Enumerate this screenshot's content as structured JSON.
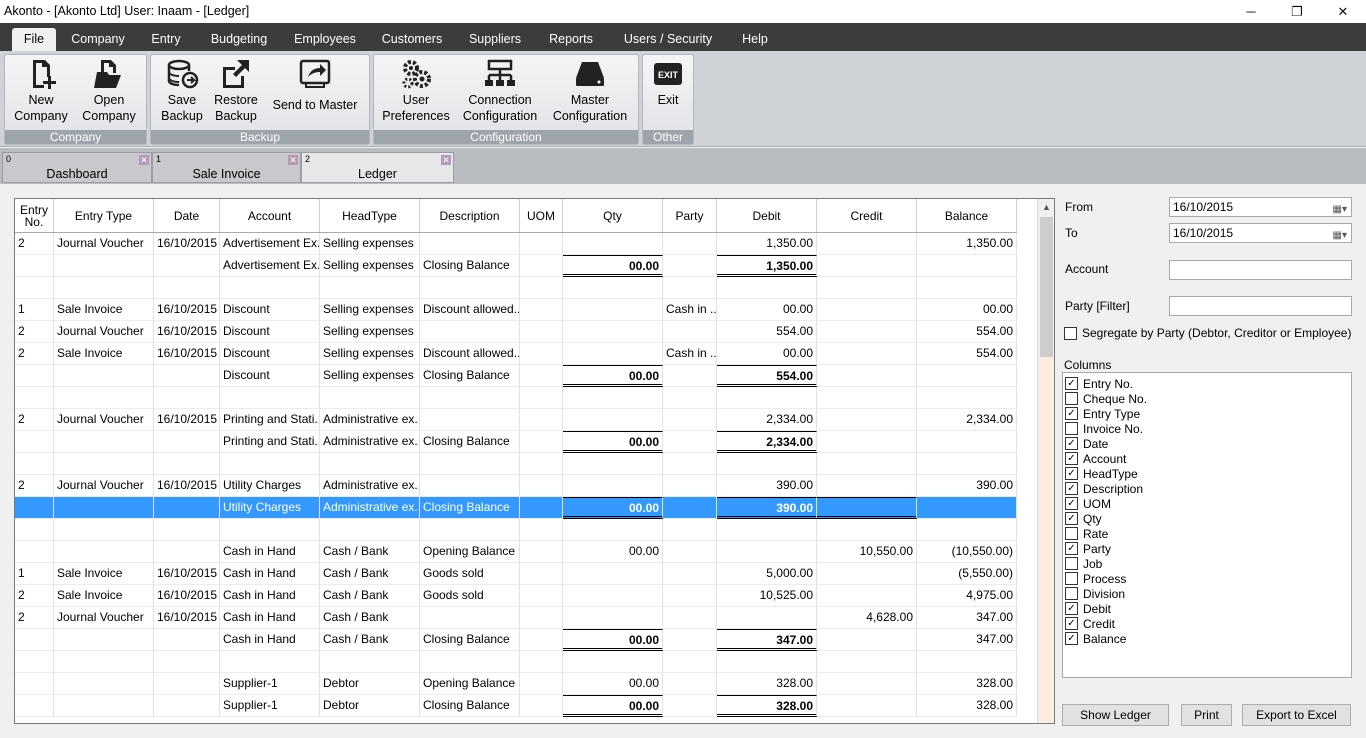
{
  "window": {
    "title": "Akonto - [Akonto Ltd]  User: Inaam - [Ledger]",
    "controls": [
      "─",
      "❐",
      "✕"
    ]
  },
  "menu": [
    "File",
    "Company",
    "Entry",
    "Budgeting",
    "Employees",
    "Customers",
    "Suppliers",
    "Reports",
    "Users / Security",
    "Help"
  ],
  "ribbon": {
    "groups": [
      {
        "label": "Company",
        "buttons": [
          "New\nCompany",
          "Open\nCompany"
        ]
      },
      {
        "label": "Backup",
        "buttons": [
          "Save\nBackup",
          "Restore\nBackup",
          "Send to Master"
        ]
      },
      {
        "label": "Configuration",
        "buttons": [
          "User\nPreferences",
          "Connection\nConfiguration",
          "Master\nConfiguration"
        ]
      },
      {
        "label": "Other",
        "buttons": [
          "Exit"
        ]
      }
    ],
    "icons": [
      "new-company-icon",
      "open-company-icon",
      "save-backup-icon",
      "restore-backup-icon",
      "send-to-master-icon",
      "user-preferences-icon",
      "connection-config-icon",
      "master-config-icon",
      "exit-icon"
    ]
  },
  "doc_tabs": [
    {
      "num": "0",
      "label": "Dashboard"
    },
    {
      "num": "1",
      "label": "Sale Invoice"
    },
    {
      "num": "2",
      "label": "Ledger"
    }
  ],
  "grid": {
    "headers": [
      "Entry\nNo.",
      "Entry Type",
      "Date",
      "Account",
      "HeadType",
      "Description",
      "UOM",
      "Qty",
      "Party",
      "Debit",
      "Credit",
      "Balance"
    ],
    "rows": [
      {
        "cells": [
          "2",
          "Journal Voucher",
          "16/10/2015",
          "Advertisement Ex...",
          "Selling expenses",
          "",
          "",
          "",
          "",
          "1,350.00",
          "",
          "1,350.00"
        ],
        "type": "data"
      },
      {
        "cells": [
          "",
          "",
          "",
          "Advertisement Ex...",
          "Selling expenses",
          "Closing Balance",
          "",
          "00.00",
          "",
          "1,350.00",
          "",
          ""
        ],
        "type": "total"
      },
      {
        "cells": [
          "",
          "",
          "",
          "",
          "",
          "",
          "",
          "",
          "",
          "",
          "",
          ""
        ],
        "type": "blank"
      },
      {
        "cells": [
          "1",
          "Sale Invoice",
          "16/10/2015",
          "Discount",
          "Selling expenses",
          "Discount allowed...",
          "",
          "",
          "Cash in ...",
          "00.00",
          "",
          "00.00"
        ],
        "type": "data"
      },
      {
        "cells": [
          "2",
          "Journal Voucher",
          "16/10/2015",
          "Discount",
          "Selling expenses",
          "",
          "",
          "",
          "",
          "554.00",
          "",
          "554.00"
        ],
        "type": "data"
      },
      {
        "cells": [
          "2",
          "Sale Invoice",
          "16/10/2015",
          "Discount",
          "Selling expenses",
          "Discount allowed...",
          "",
          "",
          "Cash in ...",
          "00.00",
          "",
          "554.00"
        ],
        "type": "data"
      },
      {
        "cells": [
          "",
          "",
          "",
          "Discount",
          "Selling expenses",
          "Closing Balance",
          "",
          "00.00",
          "",
          "554.00",
          "",
          ""
        ],
        "type": "total"
      },
      {
        "cells": [
          "",
          "",
          "",
          "",
          "",
          "",
          "",
          "",
          "",
          "",
          "",
          ""
        ],
        "type": "blank"
      },
      {
        "cells": [
          "2",
          "Journal Voucher",
          "16/10/2015",
          "Printing and Stati...",
          "Administrative ex...",
          "",
          "",
          "",
          "",
          "2,334.00",
          "",
          "2,334.00"
        ],
        "type": "data"
      },
      {
        "cells": [
          "",
          "",
          "",
          "Printing and Stati...",
          "Administrative ex...",
          "Closing Balance",
          "",
          "00.00",
          "",
          "2,334.00",
          "",
          ""
        ],
        "type": "total"
      },
      {
        "cells": [
          "",
          "",
          "",
          "",
          "",
          "",
          "",
          "",
          "",
          "",
          "",
          ""
        ],
        "type": "blank"
      },
      {
        "cells": [
          "2",
          "Journal Voucher",
          "16/10/2015",
          "Utility Charges",
          "Administrative ex...",
          "",
          "",
          "",
          "",
          "390.00",
          "",
          "390.00"
        ],
        "type": "data"
      },
      {
        "cells": [
          "",
          "",
          "",
          "Utility Charges",
          "Administrative ex...",
          "Closing Balance",
          "",
          "00.00",
          "",
          "390.00",
          "",
          ""
        ],
        "type": "total",
        "selected": true
      },
      {
        "cells": [
          "",
          "",
          "",
          "",
          "",
          "",
          "",
          "",
          "",
          "",
          "",
          ""
        ],
        "type": "blank"
      },
      {
        "cells": [
          "",
          "",
          "",
          "Cash in Hand",
          "Cash / Bank",
          "Opening Balance",
          "",
          "00.00",
          "",
          "",
          "10,550.00",
          "(10,550.00)"
        ],
        "type": "data"
      },
      {
        "cells": [
          "1",
          "Sale Invoice",
          "16/10/2015",
          "Cash in Hand",
          "Cash / Bank",
          "Goods sold",
          "",
          "",
          "",
          "5,000.00",
          "",
          "(5,550.00)"
        ],
        "type": "data"
      },
      {
        "cells": [
          "2",
          "Sale Invoice",
          "16/10/2015",
          "Cash in Hand",
          "Cash / Bank",
          "Goods sold",
          "",
          "",
          "",
          "10,525.00",
          "",
          "4,975.00"
        ],
        "type": "data"
      },
      {
        "cells": [
          "2",
          "Journal Voucher",
          "16/10/2015",
          "Cash in Hand",
          "Cash / Bank",
          "",
          "",
          "",
          "",
          "",
          "4,628.00",
          "347.00"
        ],
        "type": "data"
      },
      {
        "cells": [
          "",
          "",
          "",
          "Cash in Hand",
          "Cash / Bank",
          "Closing Balance",
          "",
          "00.00",
          "",
          "347.00",
          "",
          "347.00"
        ],
        "type": "total"
      },
      {
        "cells": [
          "",
          "",
          "",
          "",
          "",
          "",
          "",
          "",
          "",
          "",
          "",
          ""
        ],
        "type": "blank"
      },
      {
        "cells": [
          "",
          "",
          "",
          "Supplier-1",
          "Debtor",
          "Opening Balance",
          "",
          "00.00",
          "",
          "328.00",
          "",
          "328.00"
        ],
        "type": "data"
      },
      {
        "cells": [
          "",
          "",
          "",
          "Supplier-1",
          "Debtor",
          "Closing Balance",
          "",
          "00.00",
          "",
          "328.00",
          "",
          "328.00"
        ],
        "type": "total"
      }
    ]
  },
  "filters": {
    "from_label": "From",
    "from_value": "16/10/2015",
    "to_label": "To",
    "to_value": "16/10/2015",
    "account_label": "Account",
    "account_value": "",
    "party_label": "Party [Filter]",
    "party_value": "",
    "segregate_label": "Segregate by Party (Debtor, Creditor or Employee)",
    "segregate_checked": false,
    "columns_label": "Columns"
  },
  "columns": [
    {
      "label": "Entry No.",
      "checked": true
    },
    {
      "label": "Cheque No.",
      "checked": false
    },
    {
      "label": "Entry Type",
      "checked": true
    },
    {
      "label": "Invoice No.",
      "checked": false
    },
    {
      "label": "Date",
      "checked": true
    },
    {
      "label": "Account",
      "checked": true
    },
    {
      "label": "HeadType",
      "checked": true
    },
    {
      "label": "Description",
      "checked": true
    },
    {
      "label": "UOM",
      "checked": true
    },
    {
      "label": "Qty",
      "checked": true
    },
    {
      "label": "Rate",
      "checked": false
    },
    {
      "label": "Party",
      "checked": true
    },
    {
      "label": "Job",
      "checked": false
    },
    {
      "label": "Process",
      "checked": false
    },
    {
      "label": "Division",
      "checked": false
    },
    {
      "label": "Debit",
      "checked": true
    },
    {
      "label": "Credit",
      "checked": true
    },
    {
      "label": "Balance",
      "checked": true
    }
  ],
  "buttons": {
    "show_ledger": "Show Ledger",
    "print": "Print",
    "export": "Export to Excel"
  },
  "colors": {
    "menubar": "#3c3c3c",
    "selection": "#3399ff",
    "ribbon_group_label": "#9ea4ab"
  }
}
